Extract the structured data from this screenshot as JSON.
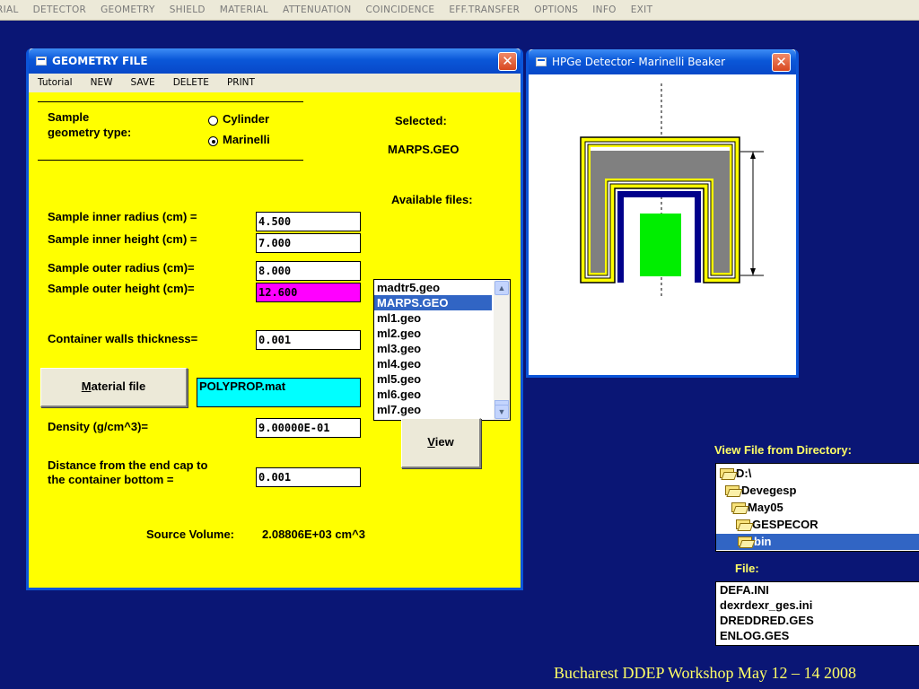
{
  "topmenu": [
    "RIAL",
    "DETECTOR",
    "GEOMETRY",
    "SHIELD",
    "MATERIAL",
    "ATTENUATION",
    "COINCIDENCE",
    "EFF.TRANSFER",
    "OPTIONS",
    "INFO",
    "EXIT"
  ],
  "geo_window": {
    "title": "GEOMETRY FILE",
    "menu": [
      "Tutorial",
      "NEW",
      "SAVE",
      "DELETE",
      "PRINT"
    ],
    "geom_type_label_1": "Sample",
    "geom_type_label_2": "geometry type:",
    "radio_cylinder": "Cylinder",
    "radio_marinelli": "Marinelli",
    "selected_radio": "Marinelli",
    "selected_label": "Selected:",
    "selected_value": "MARPS.GEO",
    "available_label": "Available files:",
    "fields": [
      {
        "label": "Sample inner radius (cm) =",
        "value": "4.500"
      },
      {
        "label": "Sample inner height (cm) =",
        "value": "7.000"
      },
      {
        "label": "Sample outer radius (cm)=",
        "value": "8.000"
      },
      {
        "label": "Sample outer height (cm)=",
        "value": "12.600"
      },
      {
        "label": "Container walls thickness=",
        "value": "0.001"
      }
    ],
    "files": [
      "madtr5.geo",
      "MARPS.GEO",
      "ml1.geo",
      "ml2.geo",
      "ml3.geo",
      "ml4.geo",
      "ml5.geo",
      "ml6.geo",
      "ml7.geo"
    ],
    "selected_file": "MARPS.GEO",
    "material_button": "aterial file",
    "material_button_mnemonic": "M",
    "material_value": "POLYPROP.mat",
    "density_label": "Density (g/cm^3)=",
    "density_value": "9.00000E-01",
    "view_button": "iew",
    "view_button_mnemonic": "V",
    "distance_label_1": "Distance from the end cap to",
    "distance_label_2": "the container bottom =",
    "distance_value": "0.001",
    "source_volume_label": "Source Volume:",
    "source_volume_value": "2.08806E+03 cm^3",
    "colors": {
      "panel": "#ffff00",
      "highlight_field": "#ff00ff",
      "material_field": "#00ffff"
    }
  },
  "hpge_window": {
    "title": "HPGe Detector- Marinelli Beaker"
  },
  "directory": {
    "label": "View File from Directory:",
    "items": [
      "D:\\",
      "Devegesp",
      "May05",
      "GESPECOR",
      "bin"
    ],
    "selected": "bin",
    "file_label": "File:",
    "files": [
      "DEFA.INI",
      "dexrdexr_ges.ini",
      "DREDDRED.GES",
      "ENLOG.GES"
    ]
  },
  "footer": "Bucharest DDEP Workshop May 12 – 14 2008"
}
